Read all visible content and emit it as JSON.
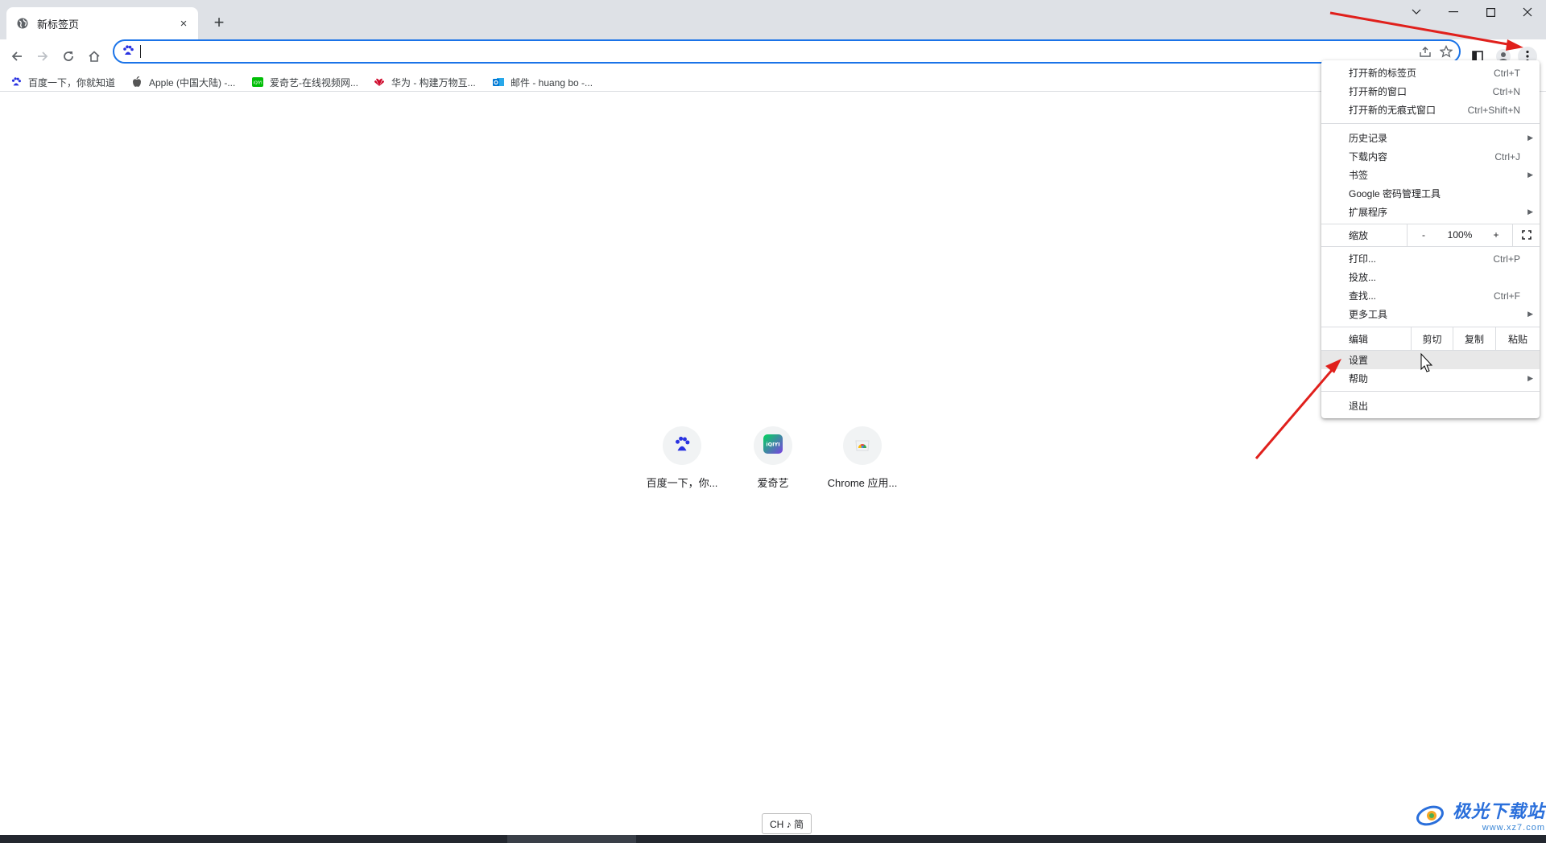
{
  "tab": {
    "title": "新标签页",
    "close_glyph": "×"
  },
  "new_tab_glyph": "+",
  "window_controls": [
    "chevron-down-icon",
    "minimize-icon",
    "maximize-icon",
    "close-icon"
  ],
  "omnibox": {
    "value": "",
    "placeholder": ""
  },
  "bookmarks": [
    {
      "label": "百度一下，你就知道",
      "icon": "baidu-paw-icon"
    },
    {
      "label": "Apple (中国大陆) -...",
      "icon": "apple-icon"
    },
    {
      "label": "爱奇艺-在线视频网...",
      "icon": "iqiyi-icon"
    },
    {
      "label": "华为 - 构建万物互...",
      "icon": "huawei-icon"
    },
    {
      "label": "邮件 - huang bo -...",
      "icon": "outlook-icon"
    }
  ],
  "shortcuts": [
    {
      "label": "百度一下，你...",
      "icon": "baidu-paw-icon"
    },
    {
      "label": "爱奇艺",
      "icon": "iqiyi-icon"
    },
    {
      "label": "Chrome 应用...",
      "icon": "chrome-webstore-icon"
    }
  ],
  "menu": {
    "group1": [
      {
        "label": "打开新的标签页",
        "shortcut": "Ctrl+T"
      },
      {
        "label": "打开新的窗口",
        "shortcut": "Ctrl+N"
      },
      {
        "label": "打开新的无痕式窗口",
        "shortcut": "Ctrl+Shift+N"
      }
    ],
    "group2": [
      {
        "label": "历史记录",
        "shortcut": ""
      },
      {
        "label": "下载内容",
        "shortcut": "Ctrl+J"
      },
      {
        "label": "书签",
        "shortcut": ""
      },
      {
        "label": "Google 密码管理工具",
        "shortcut": ""
      },
      {
        "label": "扩展程序",
        "shortcut": ""
      }
    ],
    "zoom": {
      "label": "缩放",
      "minus": "-",
      "value": "100%",
      "plus": "+"
    },
    "group3": [
      {
        "label": "打印...",
        "shortcut": "Ctrl+P"
      },
      {
        "label": "投放...",
        "shortcut": ""
      },
      {
        "label": "查找...",
        "shortcut": "Ctrl+F"
      },
      {
        "label": "更多工具",
        "shortcut": ""
      }
    ],
    "edit": {
      "label": "编辑",
      "cut": "剪切",
      "copy": "复制",
      "paste": "粘贴"
    },
    "group4": [
      {
        "label": "设置",
        "shortcut": ""
      },
      {
        "label": "帮助",
        "shortcut": ""
      }
    ],
    "exit": "退出",
    "submenu_arrow": "▶"
  },
  "ime": {
    "text": "CH ♪ 简"
  },
  "watermark": {
    "main": "极光下载站",
    "sub": "www.xz7.com"
  },
  "colors": {
    "accent": "#1a73e8",
    "annotation_arrow": "#e0201c",
    "tabstrip": "#dee1e6"
  }
}
